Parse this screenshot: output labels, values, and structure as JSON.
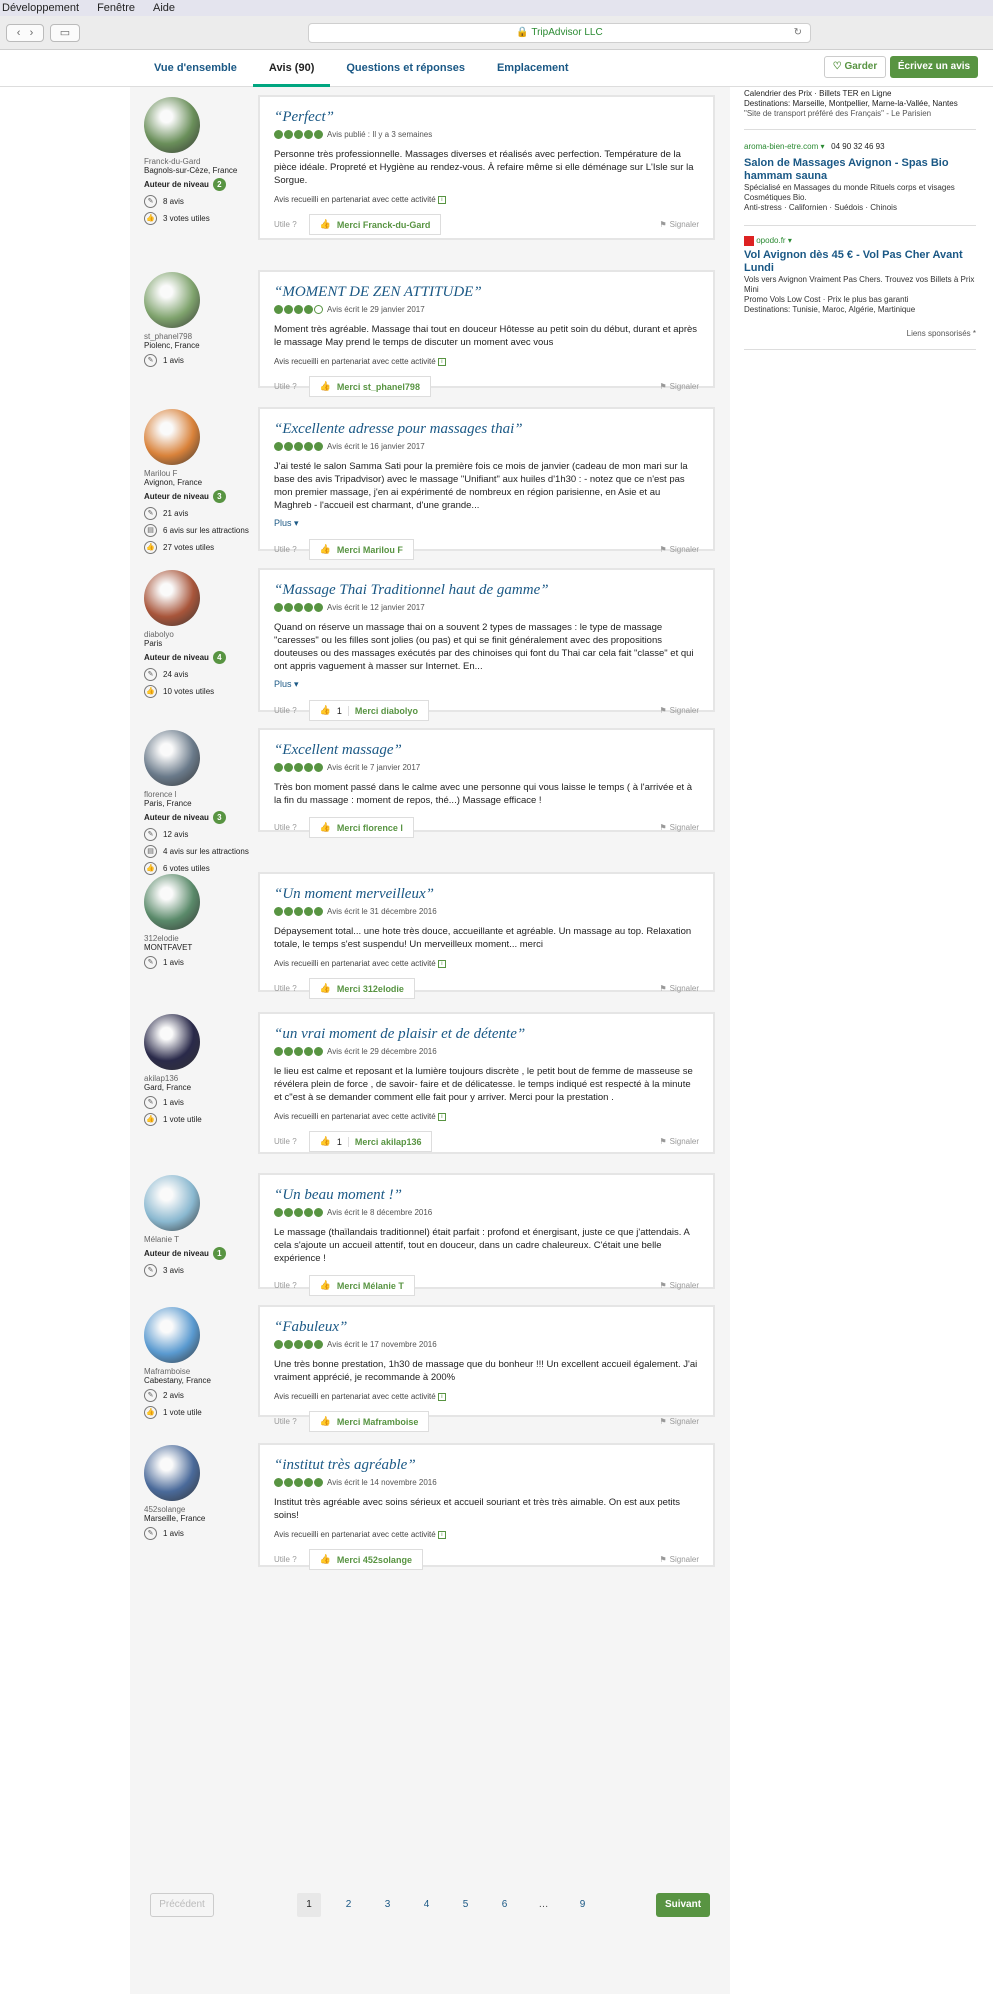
{
  "menubar": [
    "Développement",
    "Fenêtre",
    "Aide"
  ],
  "browser": {
    "url": "TripAdvisor LLC"
  },
  "tabs": [
    {
      "label": "Vue d'ensemble"
    },
    {
      "label": "Avis (90)"
    },
    {
      "label": "Questions et réponses"
    },
    {
      "label": "Emplacement"
    }
  ],
  "actions": {
    "keep": "Garder",
    "write": "Écrivez un avis"
  },
  "sidebar": {
    "top_lines": [
      "Calendrier des Prix · Billets TER en Ligne",
      "Destinations: Marseille, Montpellier, Marne-la-Vallée, Nantes",
      "\"Site de transport préféré des Français\" - Le Parisien"
    ],
    "ad1": {
      "source": "aroma-bien-etre.com ▾",
      "phone": "04 90 32 46 93",
      "title": "Salon de Massages Avignon - Spas Bio hammam sauna",
      "lines": [
        "Spécialisé en Massages du monde Rituels corps et visages Cosmétiques Bio.",
        "Anti-stress · Californien · Suédois · Chinois"
      ]
    },
    "ad2": {
      "source": "opodo.fr ▾",
      "title": "Vol Avignon dès 45 € - Vol Pas Cher Avant Lundi",
      "lines": [
        "Vols vers Avignon Vraiment Pas Chers. Trouvez vos Billets à Prix Mini",
        "Promo Vols Low Cost · Prix le plus bas garanti",
        "Destinations: Tunisie, Maroc, Algérie, Martinique"
      ]
    },
    "sponsored": "Liens sponsorisés *"
  },
  "common": {
    "useful": "Utile ?",
    "report": "Signaler",
    "partner": "Avis recueilli en partenariat avec cette activité",
    "more": "Plus",
    "level": "Auteur de niveau"
  },
  "reviews": [
    {
      "user": "Franck-du-Gard",
      "location": "Bagnols-sur-Cèze, France",
      "level": "2",
      "stats": [
        "8 avis",
        "3 votes utiles"
      ],
      "title": "“Perfect”",
      "date": "Avis publié : Il y a 3 semaines",
      "rating": 5,
      "body": "Personne très professionnelle. Massages diverses et réalisés avec perfection. Température de la pièce idéale. Propreté et Hygiène au rendez-vous. À refaire même si elle déménage sur L'Isle sur la Sorgue.",
      "more": false,
      "partner": true,
      "thanks": "Merci Franck-du-Gard",
      "count": ""
    },
    {
      "user": "st_phanel798",
      "location": "Piolenc, France",
      "level": "",
      "stats": [
        "1 avis"
      ],
      "title": "“MOMENT DE ZEN ATTITUDE”",
      "date": "Avis écrit le 29 janvier 2017",
      "rating": 4,
      "body": "Moment très agréable. Massage thai tout en douceur Hôtesse au petit soin du début, durant et après le massage May prend le temps de discuter un moment avec vous",
      "more": false,
      "partner": true,
      "thanks": "Merci st_phanel798",
      "count": ""
    },
    {
      "user": "Marilou F",
      "location": "Avignon, France",
      "level": "3",
      "stats": [
        "21 avis",
        "6 avis sur les attractions",
        "27 votes utiles"
      ],
      "title": "“Excellente adresse pour massages thai”",
      "date": "Avis écrit le 16 janvier 2017",
      "rating": 5,
      "body": "J'ai testé le salon Samma Sati pour la première fois ce mois de janvier (cadeau de mon mari sur la base des avis Tripadvisor) avec le massage \"Unifiant\" aux huiles d'1h30 : - notez que ce n'est pas mon premier massage, j'en ai expérimenté de nombreux en région parisienne, en Asie et au Maghreb - l'accueil est charmant, d'une grande...",
      "more": true,
      "partner": false,
      "thanks": "Merci Marilou F",
      "count": ""
    },
    {
      "user": "diabolyo",
      "location": "Paris",
      "level": "4",
      "stats": [
        "24 avis",
        "10 votes utiles"
      ],
      "title": "“Massage Thai Traditionnel haut de gamme”",
      "date": "Avis écrit le 12 janvier 2017",
      "rating": 5,
      "body": "Quand on réserve un massage thai on a souvent 2 types de massages : le type de massage \"caresses\" ou les filles sont jolies (ou pas) et qui se finit généralement avec des propositions douteuses ou des massages exécutés par des chinoises qui font du Thai car cela fait \"classe\" et qui ont appris vaguement à masser sur Internet. En...",
      "more": true,
      "partner": false,
      "thanks": "Merci diabolyo",
      "count": "1"
    },
    {
      "user": "florence l",
      "location": "Paris, France",
      "level": "3",
      "stats": [
        "12 avis",
        "4 avis sur les attractions",
        "6 votes utiles"
      ],
      "title": "“Excellent massage”",
      "date": "Avis écrit le 7 janvier 2017",
      "rating": 5,
      "body": "Très bon moment passé dans le calme avec une personne qui vous laisse le temps ( à l'arrivée et à la fin du massage : moment de repos, thé...) Massage efficace !",
      "more": false,
      "partner": false,
      "thanks": "Merci florence l",
      "count": ""
    },
    {
      "user": "312elodie",
      "location": "MONTFAVET",
      "level": "",
      "stats": [
        "1 avis"
      ],
      "title": "“Un moment merveilleux”",
      "date": "Avis écrit le 31 décembre 2016",
      "rating": 5,
      "body": "Dépaysement total... une hote très douce, accueillante et agréable. Un massage au top. Relaxation totale, le temps s'est suspendu! Un merveilleux moment... merci",
      "more": false,
      "partner": true,
      "thanks": "Merci 312elodie",
      "count": ""
    },
    {
      "user": "akilap136",
      "location": "Gard, France",
      "level": "",
      "stats": [
        "1 avis",
        "1 vote utile"
      ],
      "title": "“un vrai moment de plaisir et de détente”",
      "date": "Avis écrit le 29 décembre 2016",
      "rating": 5,
      "body": "le lieu est calme et reposant et la lumière toujours discrète , le petit bout de femme de masseuse se révélera plein de force , de savoir- faire et de délicatesse. le temps indiqué est respecté à la minute et c\"est à se demander comment elle fait pour y arriver. Merci pour la prestation .",
      "more": false,
      "partner": true,
      "thanks": "Merci akilap136",
      "count": "1"
    },
    {
      "user": "Mélanie T",
      "location": "",
      "level": "1",
      "stats": [
        "3 avis"
      ],
      "title": "“Un beau moment !”",
      "date": "Avis écrit le 8 décembre 2016",
      "rating": 5,
      "body": "Le massage (thaïlandais traditionnel) était parfait : profond et énergisant, juste ce que j'attendais. A cela s'ajoute un accueil attentif, tout en douceur, dans un cadre chaleureux. C'était une belle expérience !",
      "more": false,
      "partner": false,
      "thanks": "Merci Mélanie T",
      "count": ""
    },
    {
      "user": "Maframboise",
      "location": "Cabestany, France",
      "level": "",
      "stats": [
        "2 avis",
        "1 vote utile"
      ],
      "title": "“Fabuleux”",
      "date": "Avis écrit le 17 novembre 2016",
      "rating": 5,
      "body": "Une très bonne prestation, 1h30 de massage que du bonheur !!! Un excellent accueil également. J'ai vraiment apprécié, je recommande à 200%",
      "more": false,
      "partner": true,
      "thanks": "Merci Maframboise",
      "count": ""
    },
    {
      "user": "452solange",
      "location": "Marseille, France",
      "level": "",
      "stats": [
        "1 avis"
      ],
      "title": "“institut très agréable”",
      "date": "Avis écrit le 14 novembre 2016",
      "rating": 5,
      "body": "Institut très agréable avec soins sérieux et accueil souriant et très très aimable. On est aux petits soins!",
      "more": false,
      "partner": true,
      "thanks": "Merci 452solange",
      "count": ""
    }
  ],
  "pagination": {
    "prev": "Précédent",
    "pages": [
      "1",
      "2",
      "3",
      "4",
      "5",
      "6",
      "…",
      "9"
    ],
    "next": "Suivant"
  },
  "colors": {
    "green": "#589442",
    "blue": "#1a5885"
  }
}
